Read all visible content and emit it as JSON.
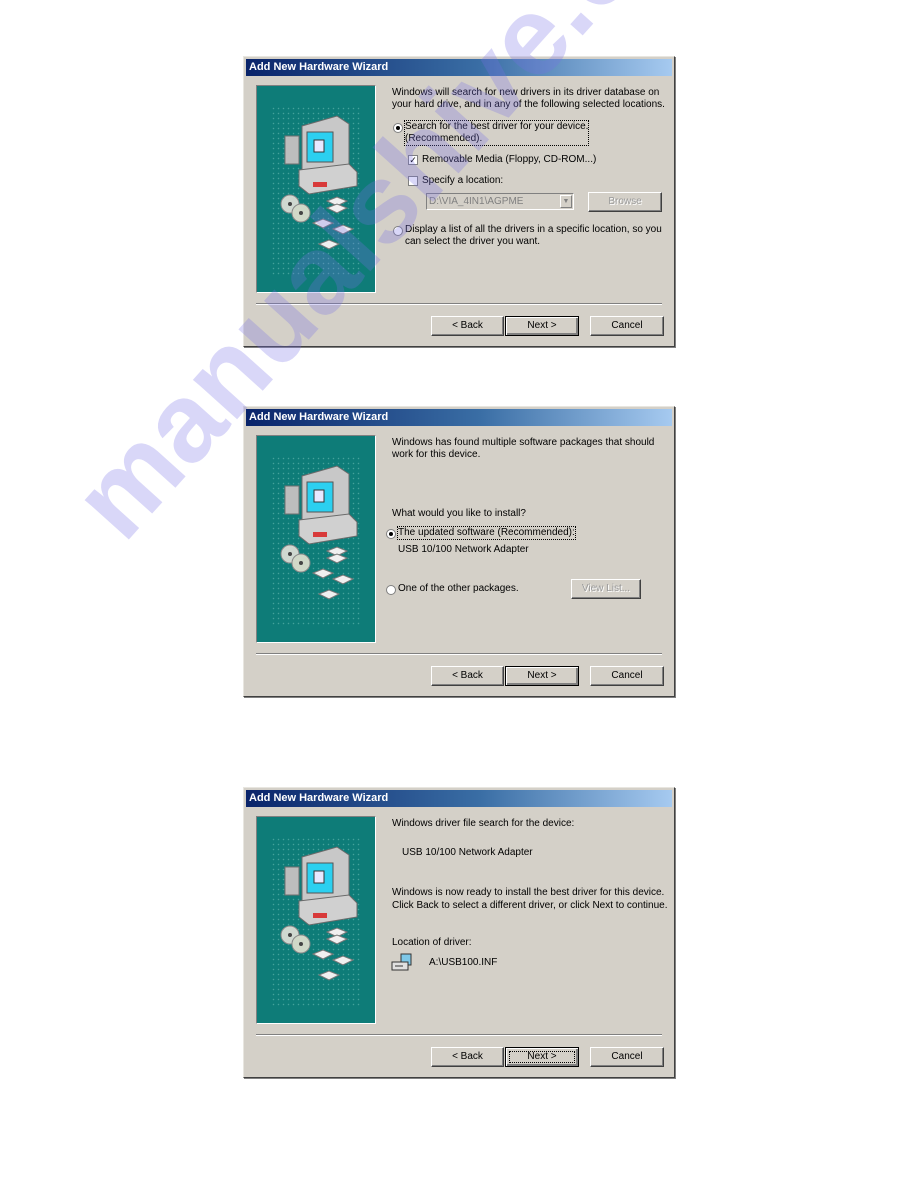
{
  "dialogs": [
    {
      "title": "Add New Hardware Wizard",
      "intro_line1": "Windows will search for new drivers in its driver database on",
      "intro_line2": "your hard drive, and in any of the following selected locations.",
      "radio_search": {
        "line1": "Search for the best driver for your device.",
        "line2": "(Recommended).",
        "selected": true
      },
      "check_removable": {
        "label": "Removable Media (Floppy, CD-ROM...)",
        "checked": true
      },
      "check_location": {
        "label": "Specify a location:",
        "checked": false
      },
      "location_value": "D:\\VIA_4IN1\\AGPME",
      "browse_label": "Browse",
      "radio_display": {
        "line1": "Display a list of all the drivers in a specific location, so you",
        "line2": "can select the driver you want.",
        "selected": false
      },
      "buttons": {
        "back": "< Back",
        "next": "Next >",
        "cancel": "Cancel"
      }
    },
    {
      "title": "Add New Hardware Wizard",
      "intro_line1": "Windows has found multiple software packages that should",
      "intro_line2": "work for this device.",
      "question": "What would you like to install?",
      "radio_updated": {
        "label": "The updated software (Recommended):",
        "selected": true
      },
      "updated_device": "USB 10/100 Network Adapter",
      "radio_other": {
        "label": "One of the other packages.",
        "selected": false
      },
      "view_list_label": "View List...",
      "buttons": {
        "back": "< Back",
        "next": "Next >",
        "cancel": "Cancel"
      }
    },
    {
      "title": "Add New Hardware Wizard",
      "heading": "Windows driver file search for the device:",
      "device": "USB 10/100 Network Adapter",
      "ready_line1": "Windows is now ready to install the best driver for this device.",
      "ready_line2": "Click Back to select a different driver, or click Next to continue.",
      "location_label": "Location of driver:",
      "driver_path": "A:\\USB100.INF",
      "buttons": {
        "back": "< Back",
        "next": "Next >",
        "cancel": "Cancel"
      }
    }
  ],
  "watermark": "manualshive.com"
}
